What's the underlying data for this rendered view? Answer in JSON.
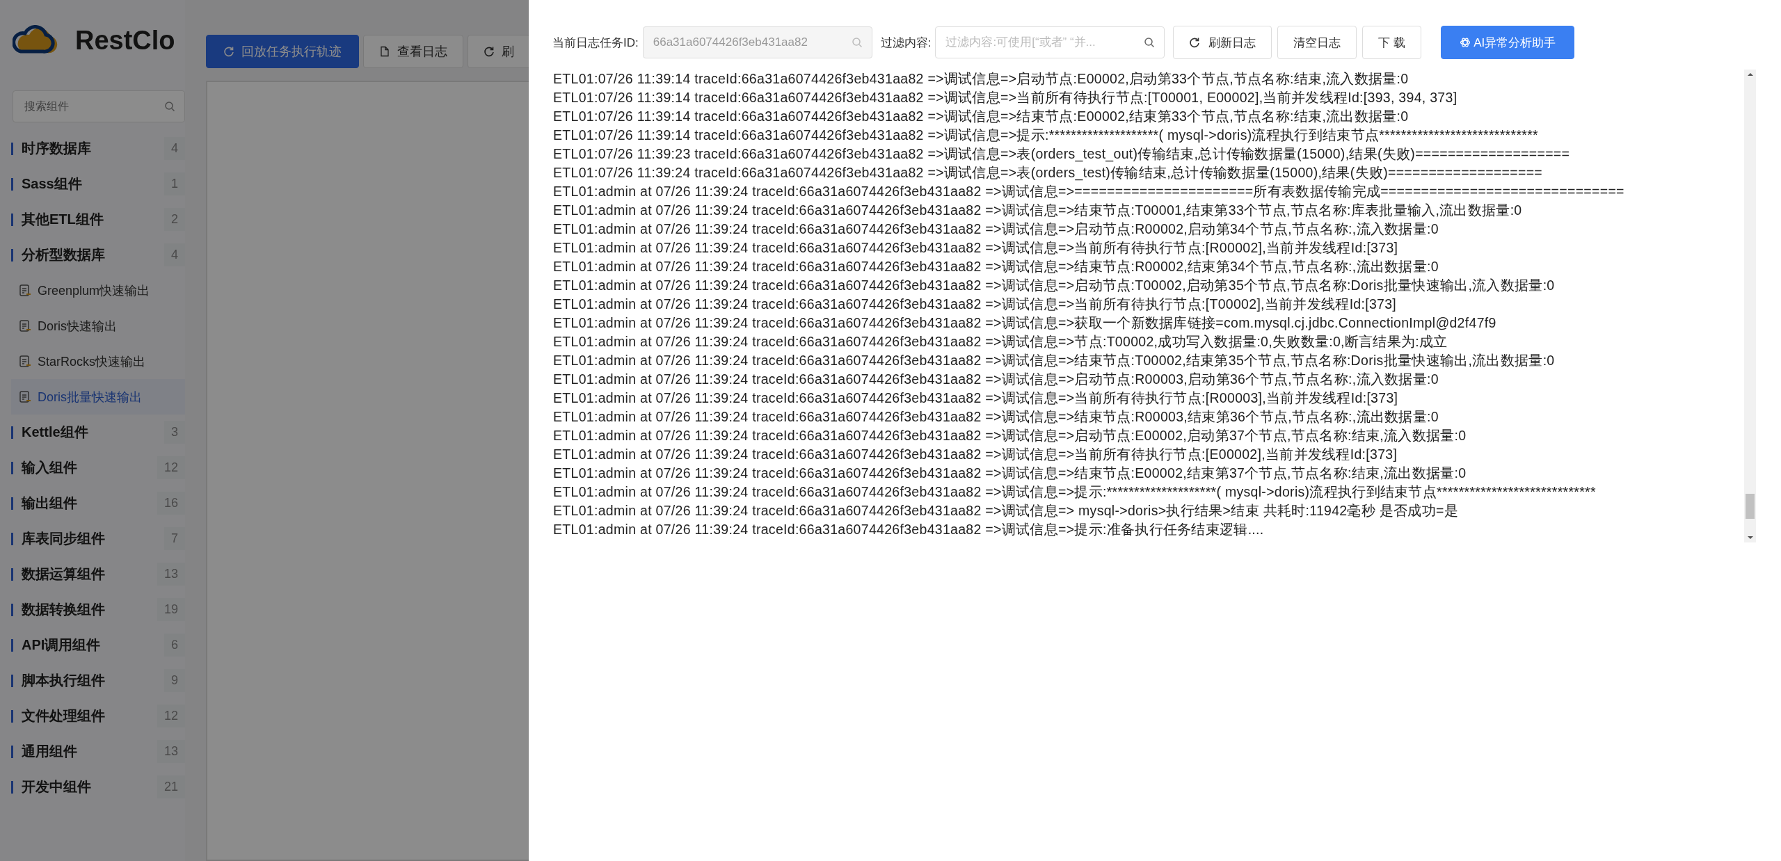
{
  "app": {
    "logo_text": "RestClo"
  },
  "sidebar": {
    "search": {
      "placeholder": "搜索组件"
    },
    "groups": [
      {
        "label": "时序数据库",
        "count": "4"
      },
      {
        "label": "Sass组件",
        "count": "1"
      },
      {
        "label": "其他ETL组件",
        "count": "2"
      },
      {
        "label": "分析型数据库",
        "count": "4",
        "children": [
          {
            "label": "Greenplum快速输出",
            "selected": false
          },
          {
            "label": "Doris快速输出",
            "selected": false
          },
          {
            "label": "StarRocks快速输出",
            "selected": false
          },
          {
            "label": "Doris批量快速输出",
            "selected": true
          }
        ]
      },
      {
        "label": "Kettle组件",
        "count": "3"
      },
      {
        "label": "输入组件",
        "count": "12"
      },
      {
        "label": "输出组件",
        "count": "16"
      },
      {
        "label": "库表同步组件",
        "count": "7"
      },
      {
        "label": "数据运算组件",
        "count": "13"
      },
      {
        "label": "数据转换组件",
        "count": "19"
      },
      {
        "label": "API调用组件",
        "count": "6"
      },
      {
        "label": "脚本执行组件",
        "count": "9"
      },
      {
        "label": "文件处理组件",
        "count": "12"
      },
      {
        "label": "通用组件",
        "count": "13"
      },
      {
        "label": "开发中组件",
        "count": "21"
      }
    ]
  },
  "main_toolbar": [
    {
      "label": "回放任务执行轨迹",
      "kind": "primary"
    },
    {
      "label": "查看日志",
      "kind": "doc"
    },
    {
      "label": "刷",
      "kind": "refresh"
    }
  ],
  "drawer": {
    "task_id_label": "当前日志任务ID:",
    "task_id_value": "66a31a6074426f3eb431aa82",
    "filter_label": "过滤内容:",
    "filter_placeholder": "过滤内容:可使用[“或者” “并...",
    "buttons": [
      {
        "label": "刷新日志",
        "kind": "refresh"
      },
      {
        "label": "清空日志",
        "kind": "plain"
      },
      {
        "label": "下 载",
        "kind": "plain"
      },
      {
        "label": "AI异常分析助手",
        "kind": "ai"
      }
    ],
    "log_lines": [
      "ETL01:07/26 11:39:14 traceId:66a31a6074426f3eb431aa82 =>调试信息=>启动节点:E00002,启动第33个节点,节点名称:结束,流入数据量:0",
      "ETL01:07/26 11:39:14 traceId:66a31a6074426f3eb431aa82 =>调试信息=>当前所有待执行节点:[T00001, E00002],当前并发线程Id:[393, 394, 373]",
      "ETL01:07/26 11:39:14 traceId:66a31a6074426f3eb431aa82 =>调试信息=>结束节点:E00002,结束第33个节点,节点名称:结束,流出数据量:0",
      "ETL01:07/26 11:39:14 traceId:66a31a6074426f3eb431aa82 =>调试信息=>提示:********************( mysql->doris)流程执行到结束节点*****************************",
      "ETL01:07/26 11:39:23 traceId:66a31a6074426f3eb431aa82 =>调试信息=>表(orders_test_out)传输结束,总计传输数据量(15000),结果(失败)===================",
      "ETL01:07/26 11:39:24 traceId:66a31a6074426f3eb431aa82 =>调试信息=>表(orders_test)传输结束,总计传输数据量(15000),结果(失败)===================",
      "ETL01:admin at 07/26 11:39:24 traceId:66a31a6074426f3eb431aa82 =>调试信息=>======================所有表数据传输完成==============================",
      "ETL01:admin at 07/26 11:39:24 traceId:66a31a6074426f3eb431aa82 =>调试信息=>结束节点:T00001,结束第33个节点,节点名称:库表批量输入,流出数据量:0",
      "ETL01:admin at 07/26 11:39:24 traceId:66a31a6074426f3eb431aa82 =>调试信息=>启动节点:R00002,启动第34个节点,节点名称:,流入数据量:0",
      "ETL01:admin at 07/26 11:39:24 traceId:66a31a6074426f3eb431aa82 =>调试信息=>当前所有待执行节点:[R00002],当前并发线程Id:[373]",
      "ETL01:admin at 07/26 11:39:24 traceId:66a31a6074426f3eb431aa82 =>调试信息=>结束节点:R00002,结束第34个节点,节点名称:,流出数据量:0",
      "ETL01:admin at 07/26 11:39:24 traceId:66a31a6074426f3eb431aa82 =>调试信息=>启动节点:T00002,启动第35个节点,节点名称:Doris批量快速输出,流入数据量:0",
      "ETL01:admin at 07/26 11:39:24 traceId:66a31a6074426f3eb431aa82 =>调试信息=>当前所有待执行节点:[T00002],当前并发线程Id:[373]",
      "ETL01:admin at 07/26 11:39:24 traceId:66a31a6074426f3eb431aa82 =>调试信息=>获取一个新数据库链接=com.mysql.cj.jdbc.ConnectionImpl@d2f47f9",
      "ETL01:admin at 07/26 11:39:24 traceId:66a31a6074426f3eb431aa82 =>调试信息=>节点:T00002,成功写入数据量:0,失败数量:0,断言结果为:成立",
      "ETL01:admin at 07/26 11:39:24 traceId:66a31a6074426f3eb431aa82 =>调试信息=>结束节点:T00002,结束第35个节点,节点名称:Doris批量快速输出,流出数据量:0",
      "ETL01:admin at 07/26 11:39:24 traceId:66a31a6074426f3eb431aa82 =>调试信息=>启动节点:R00003,启动第36个节点,节点名称:,流入数据量:0",
      "ETL01:admin at 07/26 11:39:24 traceId:66a31a6074426f3eb431aa82 =>调试信息=>当前所有待执行节点:[R00003],当前并发线程Id:[373]",
      "ETL01:admin at 07/26 11:39:24 traceId:66a31a6074426f3eb431aa82 =>调试信息=>结束节点:R00003,结束第36个节点,节点名称:,流出数据量:0",
      "ETL01:admin at 07/26 11:39:24 traceId:66a31a6074426f3eb431aa82 =>调试信息=>启动节点:E00002,启动第37个节点,节点名称:结束,流入数据量:0",
      "ETL01:admin at 07/26 11:39:24 traceId:66a31a6074426f3eb431aa82 =>调试信息=>当前所有待执行节点:[E00002],当前并发线程Id:[373]",
      "ETL01:admin at 07/26 11:39:24 traceId:66a31a6074426f3eb431aa82 =>调试信息=>结束节点:E00002,结束第37个节点,节点名称:结束,流出数据量:0",
      "ETL01:admin at 07/26 11:39:24 traceId:66a31a6074426f3eb431aa82 =>调试信息=>提示:********************( mysql->doris)流程执行到结束节点*****************************",
      "ETL01:admin at 07/26 11:39:24 traceId:66a31a6074426f3eb431aa82 =>调试信息=> mysql->doris>执行结果>结束 共耗时:11942毫秒 是否成功=是",
      "ETL01:admin at 07/26 11:39:24 traceId:66a31a6074426f3eb431aa82 =>调试信息=>提示:准备执行任务结束逻辑...."
    ]
  }
}
